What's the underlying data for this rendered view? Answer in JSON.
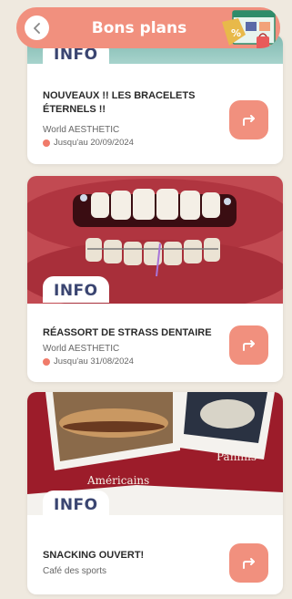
{
  "header": {
    "title": "Bons plans",
    "back_icon": "back-arrow-icon",
    "illustration_badge": "%"
  },
  "colors": {
    "accent": "#f1907e",
    "info_text": "#3a4571",
    "pizza_bg": "#9c1c2a"
  },
  "cards": [
    {
      "badge": "INFO",
      "title": "NOUVEAUX !! LES BRACELETS ÉTERNELS !!",
      "shop": "World AESTHETIC",
      "date": "Jusqu'au 20/09/2024"
    },
    {
      "badge": "INFO",
      "title": "RÉASSORT DE STRASS DENTAIRE",
      "shop": "World AESTHETIC",
      "date": "Jusqu'au 31/08/2024"
    },
    {
      "badge": "INFO",
      "title": "SNACKING OUVERT!",
      "shop": "Café des sports",
      "image_labels": [
        "Paninis",
        "Américains"
      ]
    }
  ]
}
